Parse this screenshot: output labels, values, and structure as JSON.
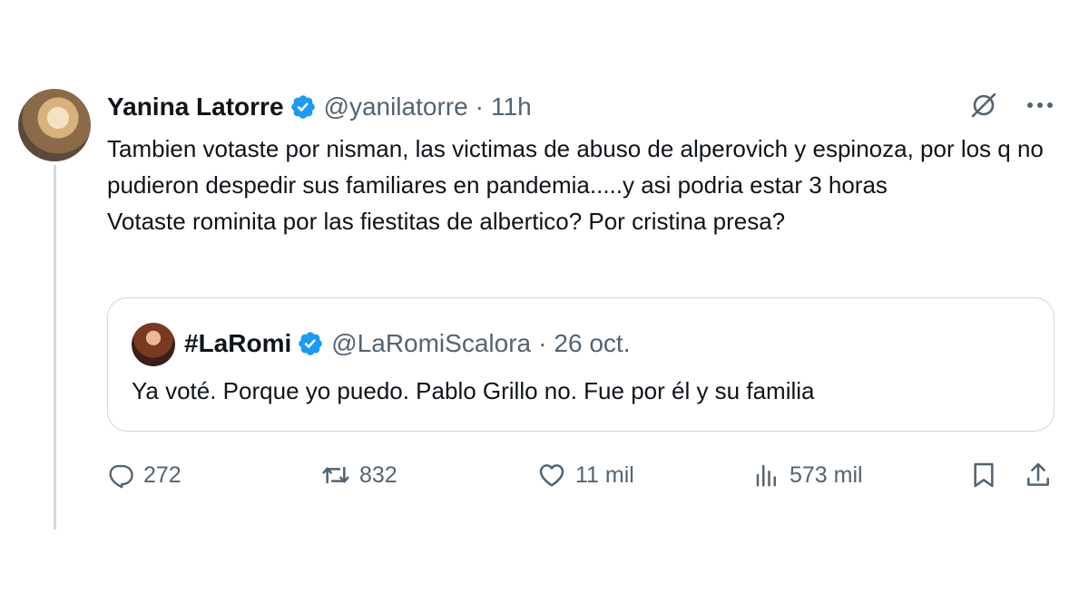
{
  "tweet": {
    "author_name": "Yanina Latorre",
    "handle": "@yanilatorre",
    "separator": "·",
    "time": "11h",
    "text_lines": [
      "Tambien votaste por nisman, las victimas de  abuso de alperovich y espinoza, por los q no pudieron despedir sus familiares en pandemia.....y asi podria estar 3 horas",
      "Votaste rominita por las fiestitas de albertico? Por cristina presa?"
    ]
  },
  "quote": {
    "author_name": "#LaRomi",
    "handle": "@LaRomiScalora",
    "separator": "·",
    "time": "26 oct.",
    "text": "Ya voté. Porque yo puedo. Pablo Grillo no. Fue por él y su familia"
  },
  "actions": {
    "replies": "272",
    "reposts": "832",
    "likes": "11 mil",
    "views": "573 mil"
  },
  "icons": {
    "verified": "verified-badge-icon",
    "grok": "grok-icon",
    "more": "more-icon",
    "reply": "reply-icon",
    "repost": "repost-icon",
    "like": "heart-icon",
    "views": "views-icon",
    "bookmark": "bookmark-icon",
    "share": "share-icon"
  },
  "colors": {
    "verified": "#1d9bf0",
    "text": "#0f1419",
    "secondary": "#536471",
    "border": "#cfd9de"
  }
}
